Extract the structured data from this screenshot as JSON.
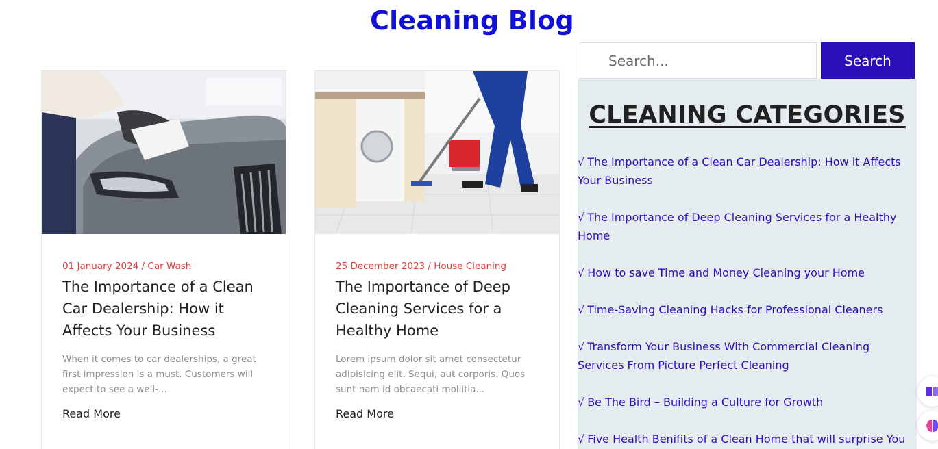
{
  "page": {
    "title": "Cleaning Blog"
  },
  "posts": [
    {
      "meta": "01 January 2024 / Car Wash",
      "title": "The Importance of a Clean Car Dealership: How it Affects Your Business",
      "excerpt": "When it comes to car dealerships, a great first impression is a must. Customers will expect to see a well-...",
      "read_more": "Read More"
    },
    {
      "meta": "25 December 2023 / House Cleaning",
      "title": "The Importance of Deep Cleaning Services for a Healthy Home",
      "excerpt": "Lorem ipsum dolor sit amet consectetur adipisicing elit. Sequi, aut corporis. Quos sunt nam id obcaecati mollitia...",
      "read_more": "Read More"
    }
  ],
  "search": {
    "placeholder": "Search...",
    "button_label": "Search"
  },
  "sidebar": {
    "heading": "CLEANING CATEGORIES",
    "check_glyph": "√",
    "categories": [
      "The Importance of a Clean Car Dealership: How it Affects Your Business",
      "The Importance of Deep Cleaning Services for a Healthy Home",
      "How to save Time and Money Cleaning your Home",
      "Time-Saving Cleaning Hacks for Professional Cleaners",
      "Transform Your Business With Commercial Cleaning Services From Picture Perfect Cleaning",
      "Be The Bird – Building a Culture for Growth",
      "Five Health Benifits of a Clean Home that will surprise You"
    ]
  },
  "floating_buttons": {
    "book_icon": "book-icon",
    "brain_icon": "brain-icon"
  },
  "colors": {
    "title": "#1010d8",
    "accent": "#2a10b9",
    "meta": "#e53838",
    "sidebar_bg": "#e5ecf0"
  }
}
